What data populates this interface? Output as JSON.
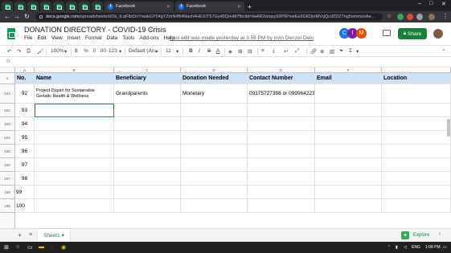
{
  "browser": {
    "tabs": [
      {
        "type": "sheets",
        "label": ""
      },
      {
        "type": "sheets",
        "label": ""
      },
      {
        "type": "sheets",
        "label": ""
      },
      {
        "type": "sheets",
        "label": ""
      },
      {
        "type": "sheets",
        "label": ""
      },
      {
        "type": "sheets",
        "label": ""
      },
      {
        "type": "sheets",
        "label": ""
      },
      {
        "type": "sheets",
        "label": ""
      },
      {
        "type": "facebook",
        "label": "Facebook"
      },
      {
        "type": "facebook",
        "label": "Facebook"
      }
    ],
    "url_domain": "docs.google.com",
    "url_path": "/spreadsheets/d/1b_tLqF8zDnYwakGY04gYZmN4B4Navh4HEXIT57Gyd0Q/edit?fbclid=IwAR2wiqxy93P6PweEs3GKDjnMVqQcdZDZ7ng5ommoxAe..."
  },
  "sheets": {
    "title": "DONATION DIRECTORY - COVID-19 Crisis",
    "menu": [
      "File",
      "Edit",
      "View",
      "Insert",
      "Format",
      "Data",
      "Tools",
      "Add-ons",
      "Help"
    ],
    "last_edit": "Last edit was made yesterday at 3:59 PM by Irvin Denzel Delo",
    "share_label": "Share",
    "avatars": [
      {
        "letter": "C",
        "color": "#1a73e8"
      },
      {
        "letter": "I",
        "color": "#7b1fa2"
      },
      {
        "letter": "M",
        "color": "#e65100"
      }
    ],
    "toolbar": {
      "zoom": "100%",
      "currency": "$",
      "percent": "%",
      "decimal_less": ".0",
      "decimal_more": ".00",
      "number_format": "123",
      "font": "Default (Ari...",
      "font_size": "11",
      "bold": "B",
      "italic": "I",
      "strike": "S",
      "text_color": "A"
    },
    "fx_label": "fx"
  },
  "grid": {
    "columns": [
      "A",
      "B",
      "C",
      "D",
      "E",
      "F"
    ],
    "header_row": {
      "row_num": "1",
      "cells": [
        "No.",
        "Name",
        "Beneficiary",
        "Donation Needed",
        "Contact Number",
        "Email",
        "Location"
      ]
    },
    "rows": [
      {
        "row_num": "151",
        "cells": [
          "92",
          "Project Duyan for Sustainable\nGeriatic Health & Wellness",
          "Grandparents",
          "Monetary",
          "09175727398 or 09996422316",
          "",
          ""
        ]
      },
      {
        "row_num": "152",
        "cells": [
          "93",
          "",
          "",
          "",
          "",
          "",
          ""
        ]
      },
      {
        "row_num": "153",
        "cells": [
          "94",
          "",
          "",
          "",
          "",
          "",
          ""
        ]
      },
      {
        "row_num": "154",
        "cells": [
          "95",
          "",
          "",
          "",
          "",
          "",
          ""
        ]
      },
      {
        "row_num": "155",
        "cells": [
          "96",
          "",
          "",
          "",
          "",
          "",
          ""
        ]
      },
      {
        "row_num": "156",
        "cells": [
          "97",
          "",
          "",
          "",
          "",
          "",
          ""
        ]
      },
      {
        "row_num": "157",
        "cells": [
          "98",
          "",
          "",
          "",
          "",
          "",
          ""
        ]
      },
      {
        "row_num": "158",
        "cells": [
          "99",
          "",
          "",
          "",
          "",
          "",
          ""
        ]
      },
      {
        "row_num": "159",
        "cells": [
          "100",
          "",
          "",
          "",
          "",
          "",
          ""
        ]
      }
    ]
  },
  "sheet_tabs": {
    "active": "Sheet1",
    "explore_label": "Explore"
  },
  "taskbar": {
    "time": "1:08 PM",
    "lang": "ENG"
  },
  "colors": {
    "header_fill": "#cfe2f3",
    "share_green": "#188038",
    "selection_blue": "#1a73e8"
  }
}
